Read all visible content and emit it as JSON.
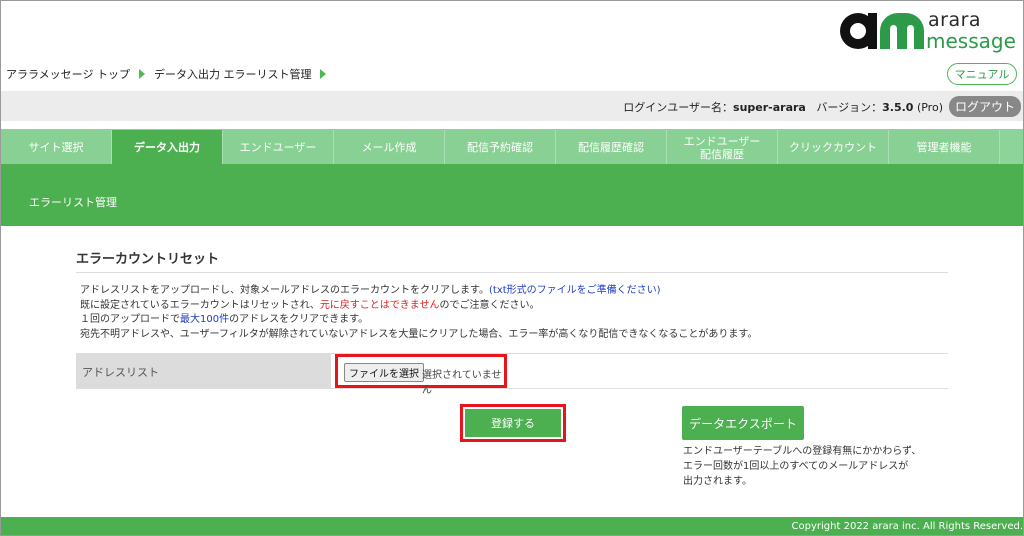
{
  "logo": {
    "word1": "arara",
    "word2": "message"
  },
  "breadcrumb": [
    "アララメッセージ トップ",
    "データ入出力 エラーリスト管理"
  ],
  "manual_label": "マニュアル",
  "user": {
    "login_label": "ログインユーザー名：",
    "login_name": "super-arara",
    "version_label": "バージョン：",
    "version": "3.5.0",
    "edition": "(Pro)",
    "logout_label": "ログアウト"
  },
  "tabs": [
    "サイト選択",
    "データ入出力",
    "エンドユーザー",
    "メール作成",
    "配信予約確認",
    "配信履歴確認",
    "エンドユーザー\n配信履歴",
    "クリックカウント",
    "管理者機能"
  ],
  "active_tab_index": 1,
  "subheader_title": "エラーリスト管理",
  "section": {
    "title": "エラーカウントリセット",
    "desc_line1_a": "アドレスリストをアップロードし、対象メールアドレスのエラーカウントをクリアします。",
    "desc_line1_b": "(txt形式のファイルをご準備ください)",
    "desc_line2_a": "既に設定されているエラーカウントはリセットされ、",
    "desc_line2_b": "元に戻すことはできません",
    "desc_line2_c": "のでご注意ください。",
    "desc_line3_a": "１回のアップロードで",
    "desc_line3_b": "最大100件",
    "desc_line3_c": "のアドレスをクリアできます。",
    "desc_line4": "宛先不明アドレスや、ユーザーフィルタが解除されていないアドレスを大量にクリアした場合、エラー率が高くなり配信できなくなることがあります。"
  },
  "address_list": {
    "label": "アドレスリスト",
    "file_button": "ファイルを選択",
    "file_status": "選択されていません"
  },
  "register_label": "登録する",
  "export": {
    "label": "データエクスポート",
    "note_line1": "エンドユーザーテーブルへの登録有無にかかわらず、",
    "note_line2": "エラー回数が1回以上のすべてのメールアドレスが",
    "note_line3": "出力されます。"
  },
  "footer": "Copyright 2022 arara inc. All Rights Reserved."
}
